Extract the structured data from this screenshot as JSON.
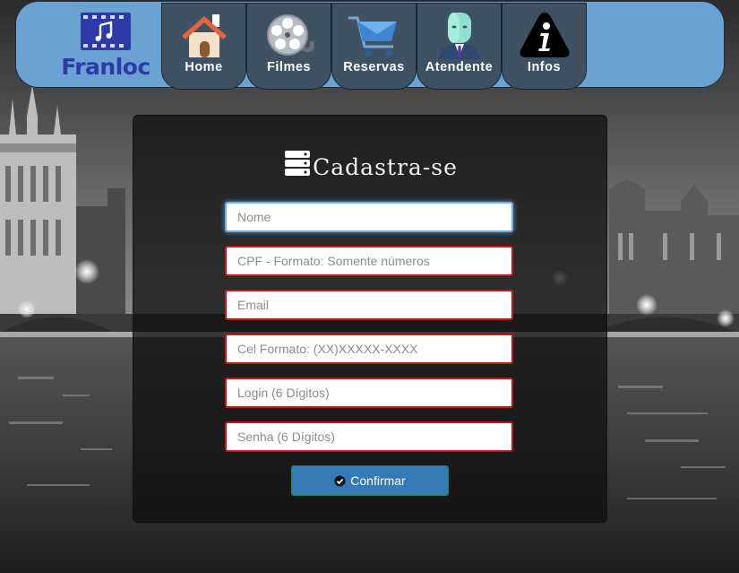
{
  "brand": {
    "name": "Franloc",
    "color": "#2f3aa9"
  },
  "nav": {
    "home": "Home",
    "filmes": "Filmes",
    "reservas": "Reservas",
    "atendente": "Atendente",
    "infos": "Infos"
  },
  "form": {
    "title": "Cadastra-se",
    "fields": {
      "nome": "Nome",
      "cpf": "CPF - Formato: Somente números",
      "email": "Email",
      "cel": "Cel Formato: (XX)XXXXX-XXXX",
      "login": "Login (6 Dígitos)",
      "senha": "Senha (6 Dígitos)"
    },
    "confirm_label": "Confirmar"
  },
  "colors": {
    "navbar": "#6aa3d2",
    "tab": "#3e5263",
    "invalid_border": "#cc1414",
    "focus_border": "#66afe9",
    "button": "#337ab7"
  }
}
